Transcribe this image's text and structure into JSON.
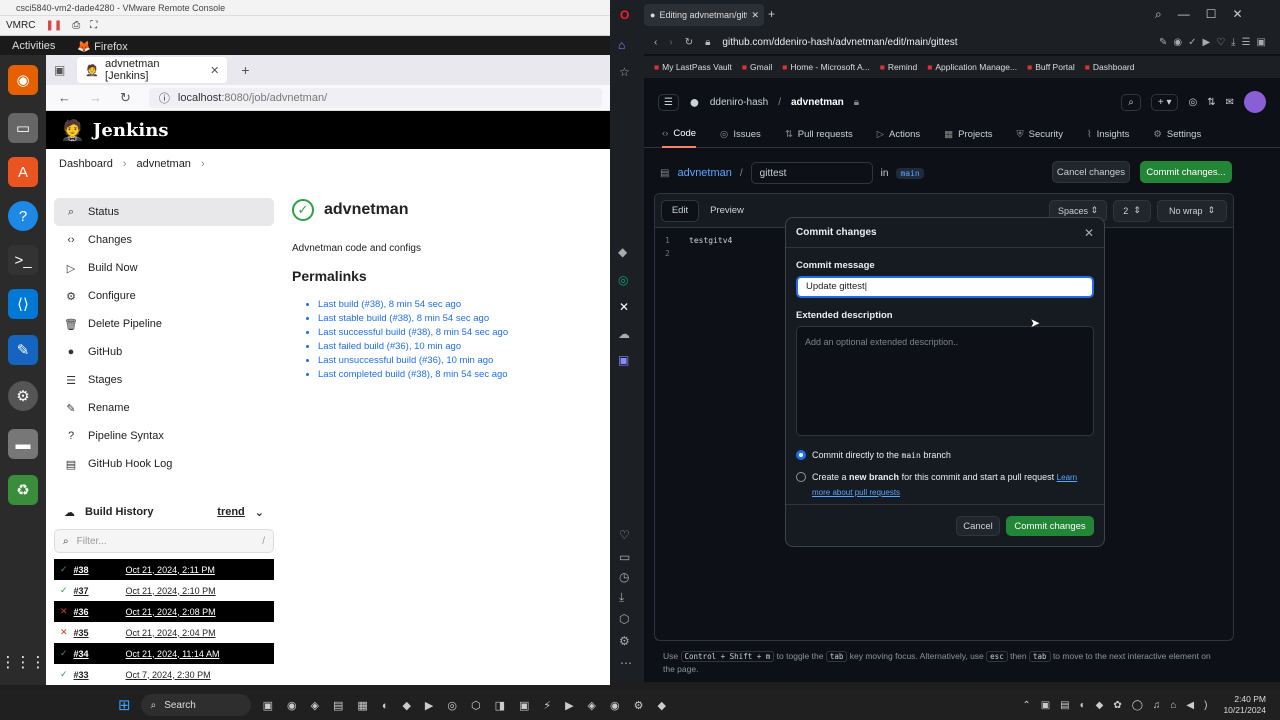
{
  "vm": {
    "title": "csci5840-vm2-dade4280 - VMware Remote Console",
    "menu_label": "VMRC"
  },
  "gnome": {
    "activities": "Activities",
    "app": "Firefox"
  },
  "firefox": {
    "tab_title": "advnetman [Jenkins]",
    "url_host": "localhost",
    "url_rest": ":8080/job/advnetman/"
  },
  "jenkins": {
    "brand": "Jenkins",
    "breadcrumb": [
      "Dashboard",
      "advnetman"
    ],
    "sidebar": [
      {
        "label": "Status",
        "icon": "magnifier-icon"
      },
      {
        "label": "Changes",
        "icon": "code-icon"
      },
      {
        "label": "Build Now",
        "icon": "play-icon"
      },
      {
        "label": "Configure",
        "icon": "gear-icon"
      },
      {
        "label": "Delete Pipeline",
        "icon": "trash-icon"
      },
      {
        "label": "GitHub",
        "icon": "github-icon"
      },
      {
        "label": "Stages",
        "icon": "stages-icon"
      },
      {
        "label": "Rename",
        "icon": "pencil-icon"
      },
      {
        "label": "Pipeline Syntax",
        "icon": "help-icon"
      },
      {
        "label": "GitHub Hook Log",
        "icon": "log-icon"
      }
    ],
    "job_title": "advnetman",
    "description": "Advnetman code and configs",
    "permalinks_heading": "Permalinks",
    "permalinks": [
      "Last build (#38), 8 min 54 sec ago",
      "Last stable build (#38), 8 min 54 sec ago",
      "Last successful build (#38), 8 min 54 sec ago",
      "Last failed build (#36), 10 min ago",
      "Last unsuccessful build (#36), 10 min ago",
      "Last completed build (#38), 8 min 54 sec ago"
    ],
    "build_history": {
      "title": "Build History",
      "trend": "trend",
      "filter_placeholder": "Filter...",
      "filter_shortcut": "/",
      "builds": [
        {
          "num": "#38",
          "date": "Oct 21, 2024, 2:11 PM",
          "status": "ok"
        },
        {
          "num": "#37",
          "date": "Oct 21, 2024, 2:10 PM",
          "status": "ok"
        },
        {
          "num": "#36",
          "date": "Oct 21, 2024, 2:08 PM",
          "status": "fail"
        },
        {
          "num": "#35",
          "date": "Oct 21, 2024, 2:04 PM",
          "status": "fail"
        },
        {
          "num": "#34",
          "date": "Oct 21, 2024, 11:14 AM",
          "status": "ok"
        },
        {
          "num": "#33",
          "date": "Oct 7, 2024, 2:30 PM",
          "status": "ok"
        }
      ]
    }
  },
  "opera": {
    "tab_title": "Editing advnetman/gittest",
    "url": "github.com/ddeniro-hash/advnetman/edit/main/gittest",
    "bookmarks": [
      "My LastPass Vault",
      "Gmail",
      "Home - Microsoft A...",
      "Remind",
      "Application Manage...",
      "Buff Portal",
      "Dashboard"
    ]
  },
  "github": {
    "owner": "ddeniro-hash",
    "repo": "advnetman",
    "tabs": [
      "Code",
      "Issues",
      "Pull requests",
      "Actions",
      "Projects",
      "Security",
      "Insights",
      "Settings"
    ],
    "path_repo": "advnetman",
    "path_sep": "/",
    "filename": "gittest",
    "in_label": "in",
    "branch": "main",
    "cancel_changes": "Cancel changes",
    "commit_changes_top": "Commit changes...",
    "edit_tab": "Edit",
    "preview_tab": "Preview",
    "indent_mode": "Spaces",
    "indent_size": "2",
    "wrap": "No wrap",
    "lines": [
      {
        "n": "1",
        "text": "testgitv4"
      },
      {
        "n": "2",
        "text": ""
      }
    ],
    "footer_note_parts": [
      "Use",
      "Control + Shift + m",
      "to toggle the",
      "tab",
      "key moving focus. Alternatively, use",
      "esc",
      "then",
      "tab",
      "to move to the next interactive element on the page."
    ]
  },
  "modal": {
    "title": "Commit changes",
    "commit_msg_label": "Commit message",
    "commit_msg_value": "Update gittest",
    "ext_desc_label": "Extended description",
    "ext_desc_placeholder": "Add an optional extended description..",
    "opt1_pre": "Commit directly to the",
    "opt1_branch": "main",
    "opt1_post": "branch",
    "opt2_pre": "Create a",
    "opt2_bold": "new branch",
    "opt2_post": "for this commit and start a pull request",
    "opt2_link": "Learn more about pull requests",
    "cancel": "Cancel",
    "submit": "Commit changes"
  },
  "taskbar": {
    "search": "Search",
    "time": "2:40 PM",
    "date": "10/21/2024"
  },
  "colors": {
    "green": "#238636",
    "link": "#1f6feb",
    "gh_bg": "#0d1117"
  }
}
